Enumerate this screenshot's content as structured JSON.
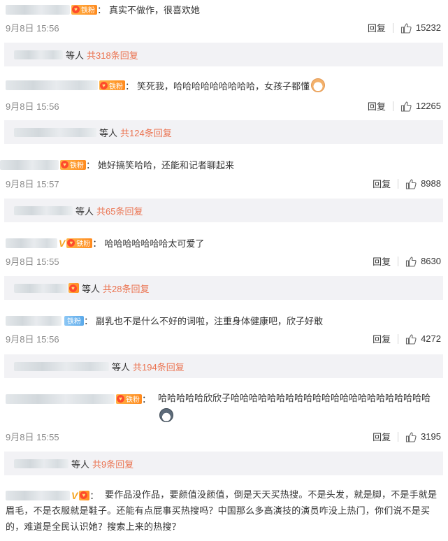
{
  "labels": {
    "reply": "回复",
    "deng_ren": "等人",
    "colon": "：",
    "fan_badge": "铁粉"
  },
  "comments": [
    {
      "text": "真实不做作，很喜欢她",
      "time": "9月8日 15:56",
      "likes": "15232",
      "reply_count": "共318条回复"
    },
    {
      "text": "笑死我，哈哈哈哈哈哈哈哈哈，女孩子都懂",
      "time": "9月8日 15:56",
      "likes": "12265",
      "reply_count": "共124条回复"
    },
    {
      "text": "她好搞笑哈哈，还能和记者聊起来",
      "time": "9月8日 15:57",
      "likes": "8988",
      "reply_count": "共65条回复"
    },
    {
      "text": "哈哈哈哈哈哈哈太可爱了",
      "time": "9月8日 15:55",
      "likes": "8630",
      "reply_count": "共28条回复"
    },
    {
      "text": "副乳也不是什么不好的词啦，注重身体健康吧，欣子好敢",
      "time": "9月8日 15:56",
      "likes": "4272",
      "reply_count": "共194条回复"
    },
    {
      "text": "哈哈哈哈哈欣欣子哈哈哈哈哈哈哈哈哈哈哈哈哈哈哈哈哈哈哈哈哈哈",
      "time": "9月8日 15:55",
      "likes": "3195",
      "reply_count": "共9条回复"
    },
    {
      "text": "要作品没作品，要颜值没颜值，倒是天天买热搜。不是头发，就是脚，不是手就是眉毛，不是衣服就是鞋子。还能有点屁事买热搜吗？中国那么多高演技的演员咋没上热门，你们说不是买的，难道是全民认识她？搜索上来的热搜？"
    }
  ]
}
